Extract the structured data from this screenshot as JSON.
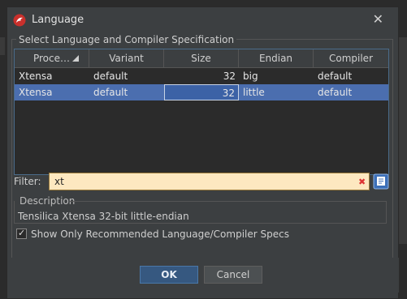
{
  "dialog": {
    "title": "Language",
    "app_icon": "dragon-logo-icon",
    "close_icon": "close-icon",
    "close_glyph": "✕"
  },
  "group": {
    "title": "Select Language and Compiler Specification"
  },
  "table": {
    "headers": [
      "Proce…",
      "Variant",
      "Size",
      "Endian",
      "Compiler"
    ],
    "sort_icon": "sort-ascending-icon",
    "rows": [
      [
        "Xtensa",
        "default",
        "32",
        "big",
        "default"
      ],
      [
        "Xtensa",
        "default",
        "32",
        "little",
        "default"
      ]
    ],
    "selected_row_index": 1
  },
  "filter": {
    "label": "Filter:",
    "value": "xt",
    "clear_icon": "clear-filter-icon",
    "clear_glyph": "✖",
    "options_icon": "filter-options-icon"
  },
  "description": {
    "title": "Description",
    "text": "Tensilica Xtensa 32-bit little-endian"
  },
  "recommended": {
    "label": "Show Only Recommended Language/Compiler Specs",
    "checked": true,
    "check_glyph": "✓"
  },
  "buttons": {
    "ok": "OK",
    "cancel": "Cancel"
  },
  "colors": {
    "background": "#3c3f41",
    "selection": "#4b6eaf",
    "filter_bg": "#fde8c0",
    "ok_button": "#365880"
  }
}
